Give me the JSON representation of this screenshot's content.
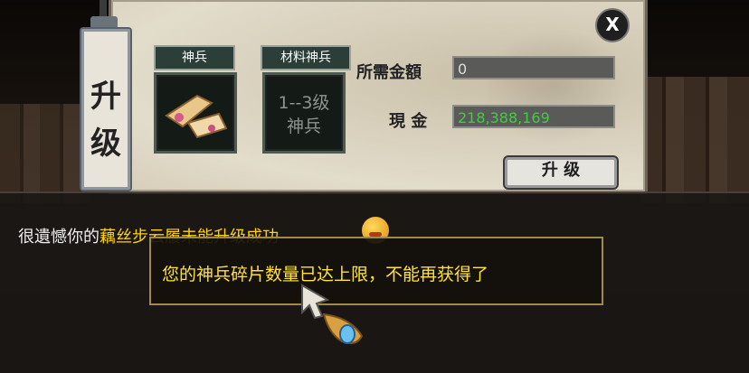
{
  "panel": {
    "tab_title_1": "升",
    "tab_title_2": "级",
    "close_label": "X",
    "slot1_label": "神兵",
    "slot2_label": "材料神兵",
    "slot2_line1": "1--3级",
    "slot2_line2": "神兵",
    "required_label": "所需金額",
    "required_value": "0",
    "cash_label": "現  金",
    "cash_value": "218,388,169",
    "upgrade_label": "升  级"
  },
  "chat": {
    "prefix": "很遺憾你的",
    "highlight": "藕",
    "suffix": "丝步云履未能升级成功"
  },
  "tooltip": {
    "message": "您的神兵碎片数量已达上限，不能再获得了"
  },
  "colors": {
    "money": "#3ecf3e",
    "tooltip_text": "#ffe23a",
    "tooltip_border": "#a08a4a"
  }
}
